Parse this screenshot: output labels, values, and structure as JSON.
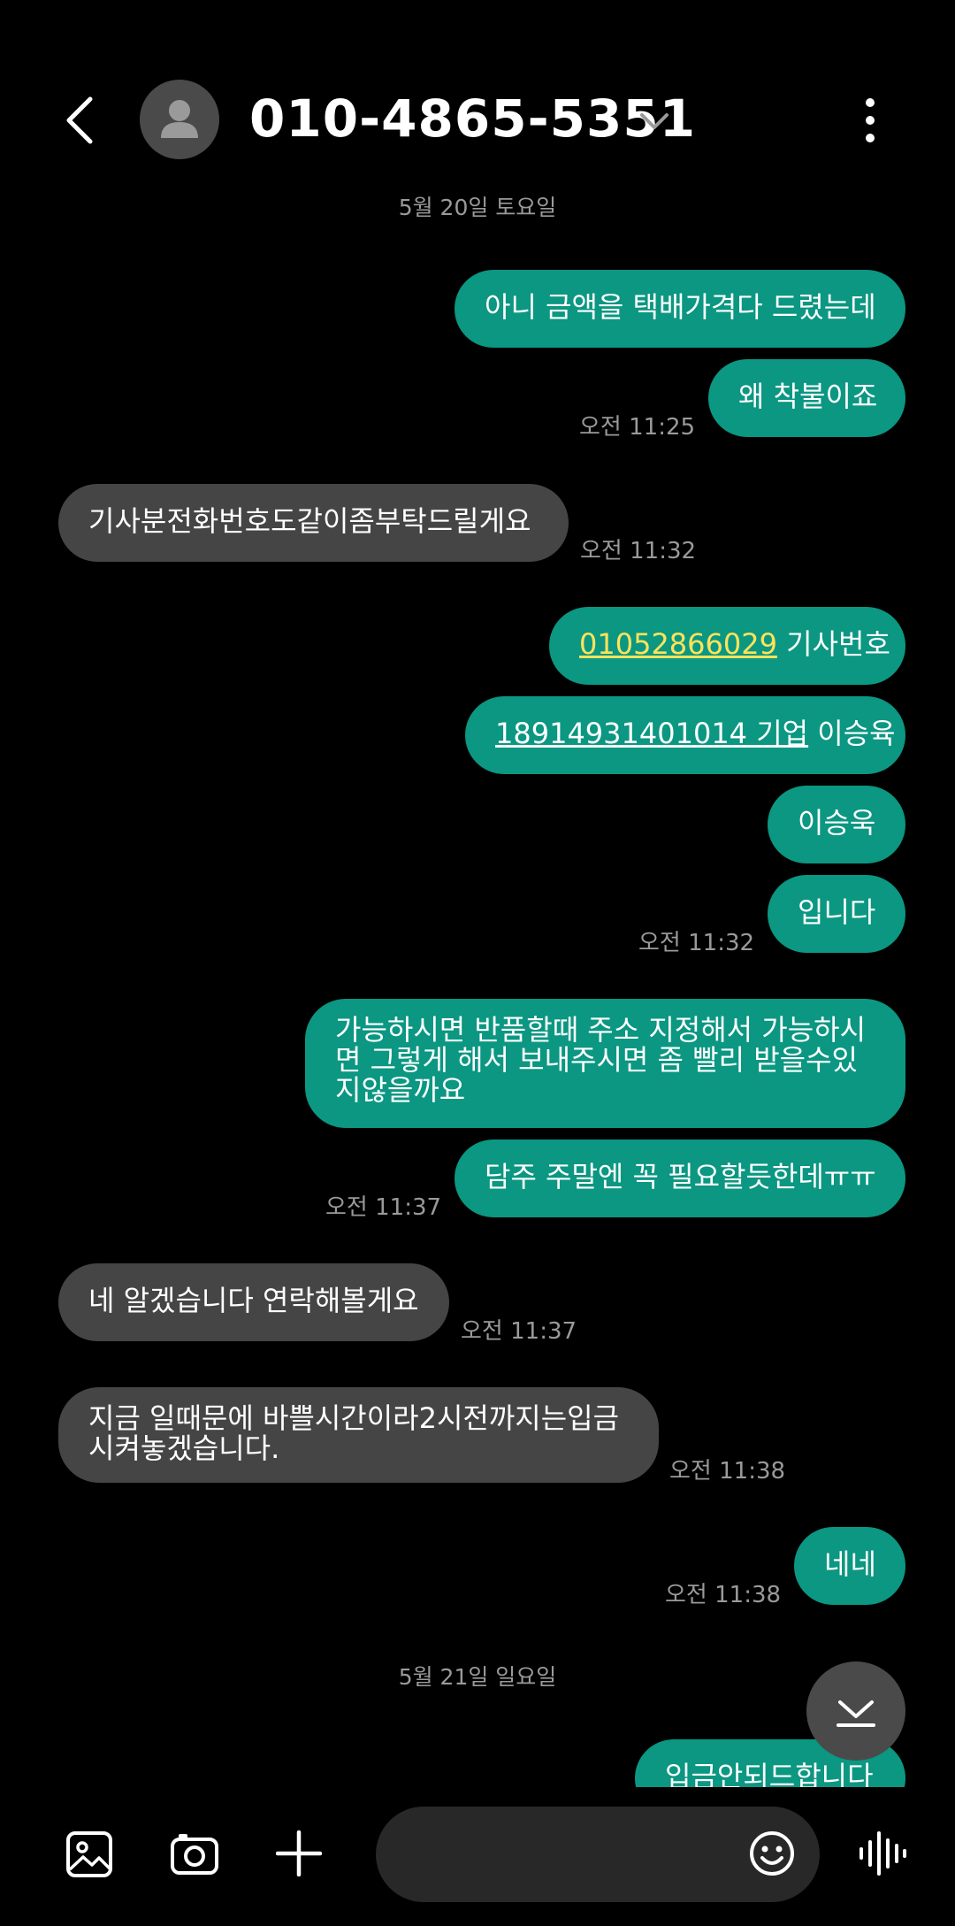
{
  "header": {
    "title": "010-4865-5351",
    "icons": {
      "back": "back-arrow-icon",
      "avatar": "person-icon",
      "expand": "chevron-down-icon",
      "menu": "more-vertical-icon"
    }
  },
  "messages": {
    "date1": "5월 20일 토요일",
    "m1": "아니 금액을 택배가격다 드렸는데",
    "m2": "왜 착불이죠",
    "t1": "오전 11:25",
    "m3": "기사분전화번호도같이좀부탁드릴게요",
    "t2": "오전 11:32",
    "m4_phone": "01052866029",
    "m4_rest": " 기사번호",
    "m5_link": "18914931401014 기업",
    "m5_rest": " 이승육",
    "m6": "이승욱",
    "m7": "입니다",
    "t3": "오전 11:32",
    "m8_l1": "가능하시면 반품할때 주소 지정해서 가능하시",
    "m8_l2": "면 그렇게 해서 보내주시면 좀 빨리 받을수있",
    "m8_l3": "지않을까요",
    "m9": "담주 주말엔 꼭 필요할듯한데ㅠㅠ",
    "t4": "오전 11:37",
    "m10": "네 알겠습니다 연락해볼게요",
    "t5": "오전 11:37",
    "m11_l1": "지금 일때문에 바쁠시간이라2시전까지는입금",
    "m11_l2": "시켜놓겠습니다.",
    "t6": "오전 11:38",
    "m12": "네네",
    "t7": "오전 11:38",
    "date2": "5월 21일 일요일",
    "m13_partial": "입금안되드합니다"
  },
  "bottom": {
    "icons": [
      "gallery-icon",
      "camera-icon",
      "plus-icon",
      "emoji-icon",
      "voice-icon"
    ],
    "scroll_down": "scroll-down-icon"
  },
  "colors": {
    "outgoing": "#0b9782",
    "incoming": "#454545",
    "background": "#000000",
    "link_highlight": "#ffe35a"
  }
}
